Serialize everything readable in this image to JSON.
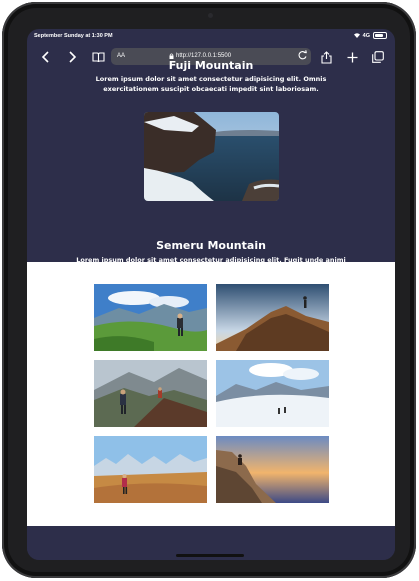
{
  "status": {
    "time": "September Sunday at 1:30 PM",
    "network": "4G"
  },
  "browser": {
    "text_size": "AA",
    "url": "http://127.0.0.1:5500"
  },
  "cards": [
    {
      "title": "Fuji Mountain",
      "description": "Lorem ipsum dolor sit amet consectetur adipisicing elit. Omnis exercitationem suscipit obcaecati impedit sint laboriosam."
    },
    {
      "title": "Semeru Mountain",
      "description": "Lorem ipsum dolor sit amet consectetur adipisicing elit. Fugit unde animi delectus harum, quisquam consequuntur!"
    }
  ],
  "icons": [
    "back-icon",
    "forward-icon",
    "book-icon",
    "lock-icon",
    "reload-icon",
    "share-icon",
    "plus-icon",
    "tabs-icon",
    "wifi-icon",
    "battery-icon"
  ]
}
